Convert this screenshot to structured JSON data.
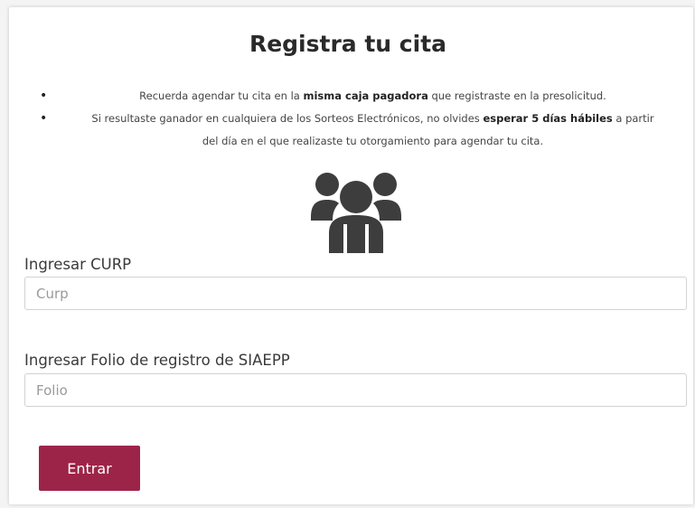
{
  "page": {
    "title": "Registra tu cita"
  },
  "notices": [
    {
      "pre": "Recuerda agendar tu cita en la ",
      "bold": "misma caja pagadora",
      "post": " que registraste en la presolicitud."
    },
    {
      "pre": "Si resultaste ganador en cualquiera de los Sorteos Electrónicos, no olvides ",
      "bold": "esperar 5 días hábiles",
      "post": " a partir del día en el que realizaste tu otorgamiento para agendar tu cita."
    }
  ],
  "icon": {
    "name": "users-group-icon",
    "color": "#3d3d3d"
  },
  "form": {
    "curp": {
      "label": "Ingresar CURP",
      "placeholder": "Curp",
      "value": ""
    },
    "folio": {
      "label": "Ingresar Folio de registro de SIAEPP",
      "placeholder": "Folio",
      "value": ""
    },
    "submit_label": "Entrar"
  },
  "colors": {
    "accent": "#9d2449",
    "text": "#333333"
  }
}
